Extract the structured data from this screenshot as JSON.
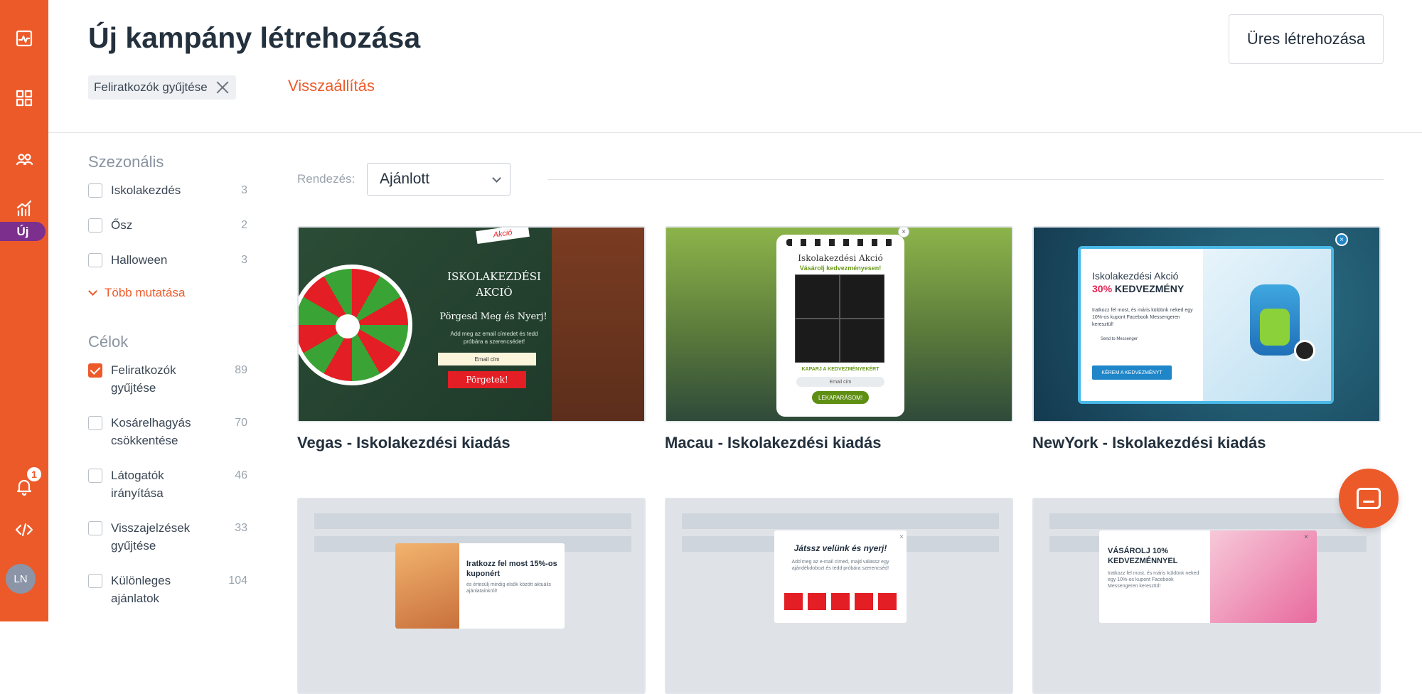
{
  "header": {
    "title": "Új kampány létrehozása",
    "empty_button": "Üres létrehozása",
    "active_filter_chip": "Feliratkozók gyűjtése",
    "reset_link": "Visszaállítás"
  },
  "rail": {
    "new_badge": "Új",
    "notification_count": "1",
    "avatar_initials": "LN",
    "icons": [
      "activity-icon",
      "dashboard-grid-icon",
      "users-icon",
      "analytics-icon",
      "bell-icon",
      "code-icon"
    ]
  },
  "filters": {
    "seasonal": {
      "title": "Szezonális",
      "items": [
        {
          "label": "Iskolakezdés",
          "count": "3",
          "checked": false
        },
        {
          "label": "Ősz",
          "count": "2",
          "checked": false
        },
        {
          "label": "Halloween",
          "count": "3",
          "checked": false
        }
      ],
      "show_more": "Több mutatása"
    },
    "goals": {
      "title": "Célok",
      "items": [
        {
          "label": "Feliratkozók gyűjtése",
          "count": "89",
          "checked": true
        },
        {
          "label": "Kosárelhagyás csökkentése",
          "count": "70",
          "checked": false
        },
        {
          "label": "Látogatók irányítása",
          "count": "46",
          "checked": false
        },
        {
          "label": "Visszajelzések gyűjtése",
          "count": "33",
          "checked": false
        },
        {
          "label": "Különleges ajánlatok",
          "count": "104",
          "checked": false
        }
      ]
    }
  },
  "sort": {
    "label": "Rendezés:",
    "selected": "Ajánlott"
  },
  "templates": [
    {
      "title": "Vegas - Iskolakezdési kiadás",
      "preview": {
        "ribbon": "Akció",
        "heading": "ISKOLAKEZDÉSI AKCIÓ",
        "sub": "Pörgesd Meg és Nyerj!",
        "text": "Add meg az email címedet és tedd próbára a szerencsédet!",
        "input": "Email cím",
        "button": "Pörgetek!"
      }
    },
    {
      "title": "Macau - Iskolakezdési kiadás",
      "preview": {
        "heading": "Iskolakezdési Akció",
        "sub": "Vásárolj kedvezményesen!",
        "cta": "KAPARJ A KEDVEZMÉNYEKÉRT",
        "input": "Email cím",
        "button": "LEKAPARÁSOM!",
        "close": "×"
      }
    },
    {
      "title": "NewYork - Iskolakezdési kiadás",
      "preview": {
        "heading": "Iskolakezdési Akció",
        "pct": "30%",
        "discount": " KEDVEZMÉNY",
        "text": "Iratkozz fel most, és máris küldünk neked egy 10%-os kupont Facebook Messengeren keresztül!",
        "messenger": "Send to  Messenger",
        "button": "KÉREM A KEDVEZMÉNYT",
        "close": "×"
      }
    },
    {
      "preview": {
        "heading": "Iratkozz fel most 15%-os kuponért",
        "text": "és értesülj mindig elsők között aktuális ajánlatainkról!"
      }
    },
    {
      "preview": {
        "heading": "Játssz velünk és nyerj!",
        "text": "Add meg az e-mail címed, majd válassz egy ajándékdobozt és tedd próbára szerencséd!",
        "close": "×"
      }
    },
    {
      "preview": {
        "heading": "VÁSÁROLJ 10% KEDVEZMÉNNYEL",
        "text": "Iratkozz fel most, és máris küldünk neked egy 10%-os kupont Facebook Messengeren keresztül!",
        "close": "×"
      }
    }
  ],
  "colors": {
    "brand_orange": "#ed5a29",
    "new_badge_purple": "#7c2f8c",
    "text_dark": "#23303d"
  }
}
